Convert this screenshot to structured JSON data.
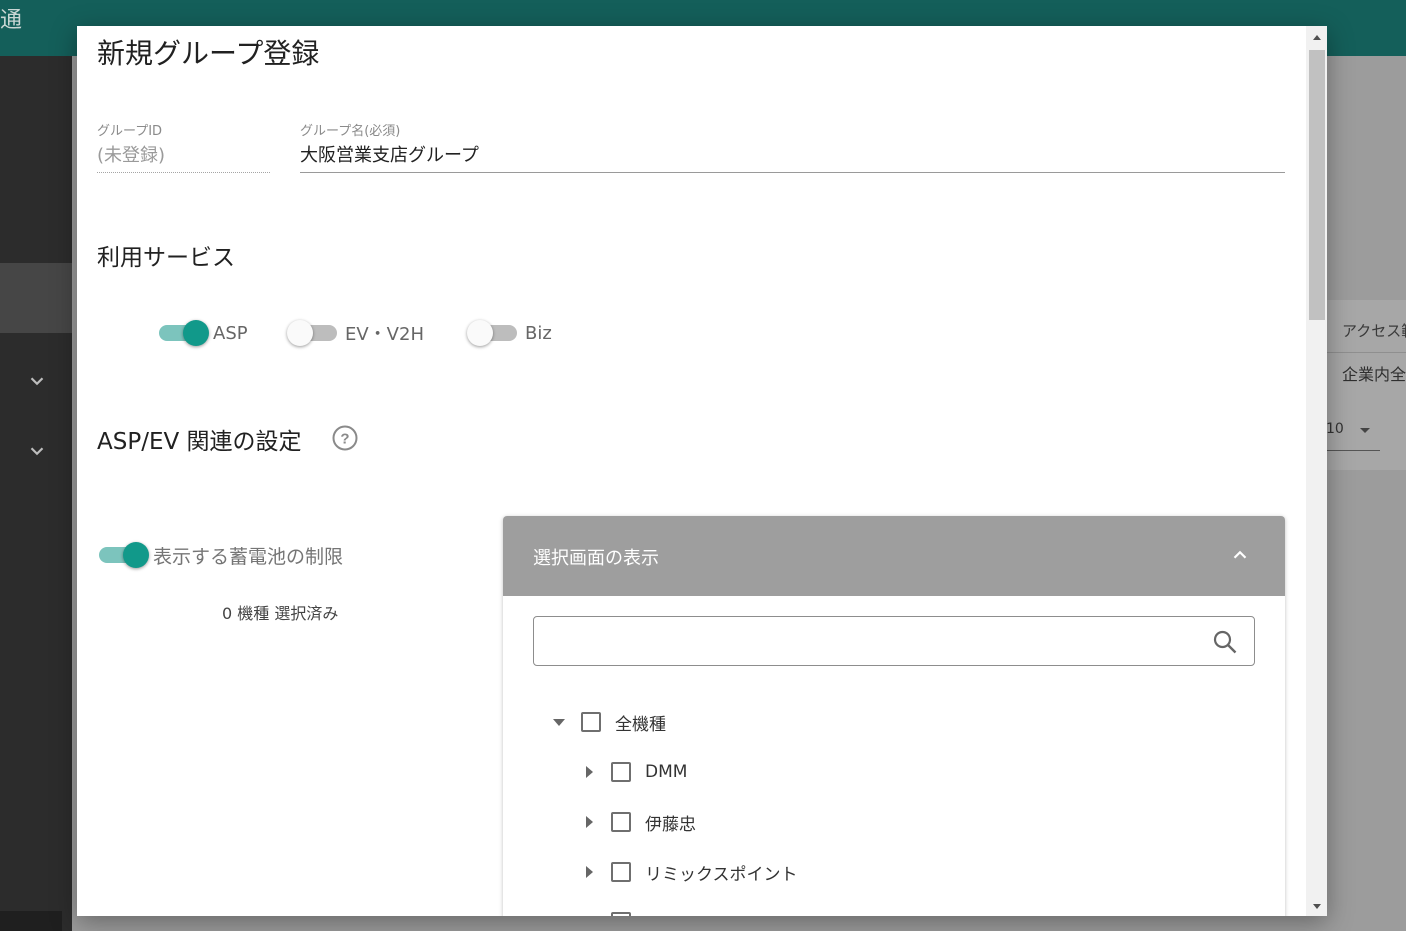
{
  "app": {
    "header_title": "通"
  },
  "background": {
    "access_label": "アクセス範",
    "company_value": "企業内全",
    "pager_value": "10"
  },
  "dialog": {
    "title": "新規グループ登録",
    "group_id": {
      "label": "グループID",
      "value": "(未登録)"
    },
    "group_name": {
      "label": "グループ名(必須)",
      "value": "大阪営業支店グループ"
    },
    "services": {
      "title": "利用サービス",
      "toggles": [
        {
          "label": "ASP",
          "on": true
        },
        {
          "label": "EV・V2H",
          "on": false
        },
        {
          "label": "Biz",
          "on": false
        }
      ]
    },
    "asp_settings": {
      "title": "ASP/EV 関連の設定",
      "battery_limit": {
        "label": "表示する蓄電池の制限",
        "on": true
      },
      "selected_count": "0 機種 選択済み"
    },
    "selection": {
      "header": "選択画面の表示",
      "search_placeholder": "",
      "tree": [
        {
          "label": "全機種",
          "expanded": true,
          "checked": false
        },
        {
          "label": "DMM",
          "expanded": false,
          "checked": false
        },
        {
          "label": "伊藤忠",
          "expanded": false,
          "checked": false
        },
        {
          "label": "リミックスポイント",
          "expanded": false,
          "checked": false
        }
      ]
    }
  },
  "colors": {
    "header_teal": "#145f5a",
    "toggle_on": "#11998a",
    "toggle_track_on": "#7cc4bd",
    "overlay": "#9e9e9e"
  }
}
